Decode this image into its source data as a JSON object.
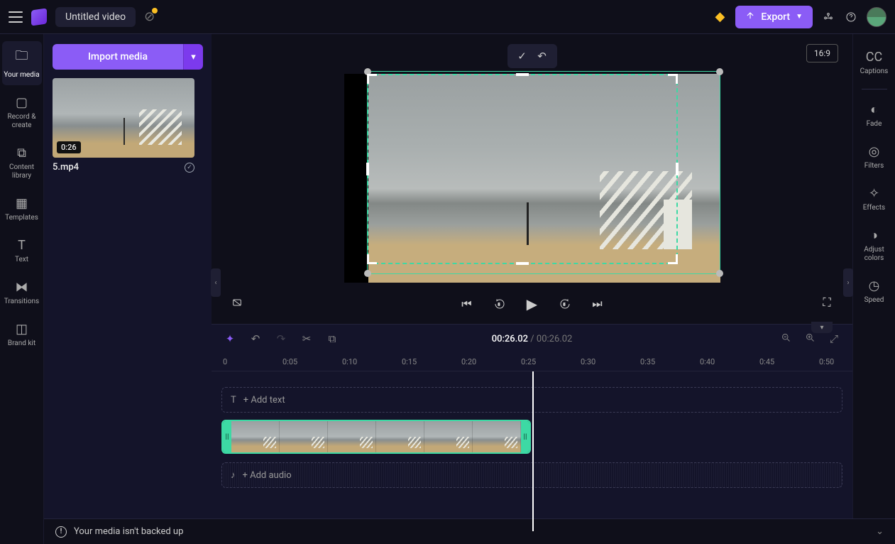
{
  "header": {
    "title": "Untitled video",
    "export_label": "Export"
  },
  "left_rail": {
    "items": [
      {
        "id": "your-media",
        "label": "Your media"
      },
      {
        "id": "record",
        "label": "Record & create"
      },
      {
        "id": "content-library",
        "label": "Content library"
      },
      {
        "id": "templates",
        "label": "Templates"
      },
      {
        "id": "text",
        "label": "Text"
      },
      {
        "id": "transitions",
        "label": "Transitions"
      },
      {
        "id": "brand-kit",
        "label": "Brand kit"
      }
    ]
  },
  "media_panel": {
    "import_label": "Import media",
    "clip": {
      "name": "5.mp4",
      "duration": "0:26"
    }
  },
  "preview": {
    "aspect": "16:9"
  },
  "timeline": {
    "current_time": "00:26.02",
    "total_time": "00:26.02",
    "ruler": [
      "0",
      "0:05",
      "0:10",
      "0:15",
      "0:20",
      "0:25",
      "0:30",
      "0:35",
      "0:40",
      "0:45",
      "0:50"
    ],
    "add_text_label": "+ Add text",
    "add_audio_label": "+ Add audio"
  },
  "right_rail": {
    "items": [
      {
        "id": "captions",
        "label": "Captions"
      },
      {
        "id": "fade",
        "label": "Fade"
      },
      {
        "id": "filters",
        "label": "Filters"
      },
      {
        "id": "effects",
        "label": "Effects"
      },
      {
        "id": "adjust",
        "label": "Adjust colors"
      },
      {
        "id": "speed",
        "label": "Speed"
      }
    ]
  },
  "footer": {
    "message": "Your media isn't backed up"
  }
}
